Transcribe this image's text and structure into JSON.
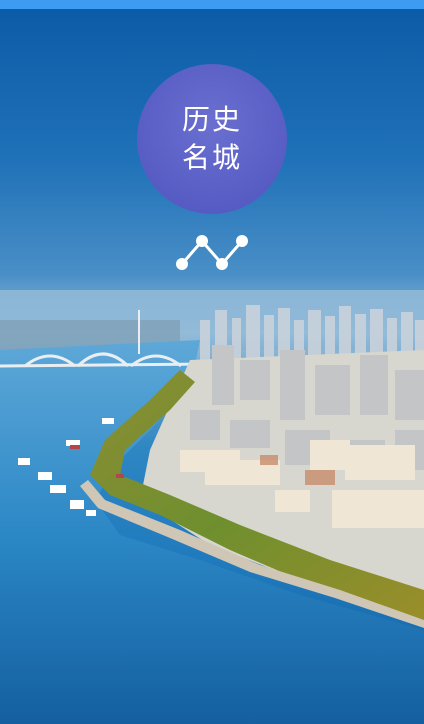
{
  "app": {
    "status_bar_color": "#3d9cf2"
  },
  "badge": {
    "line1": "历史",
    "line2": "名城",
    "color": "#5a5fc6"
  },
  "icons": {
    "trend": "line-chart-icon"
  }
}
